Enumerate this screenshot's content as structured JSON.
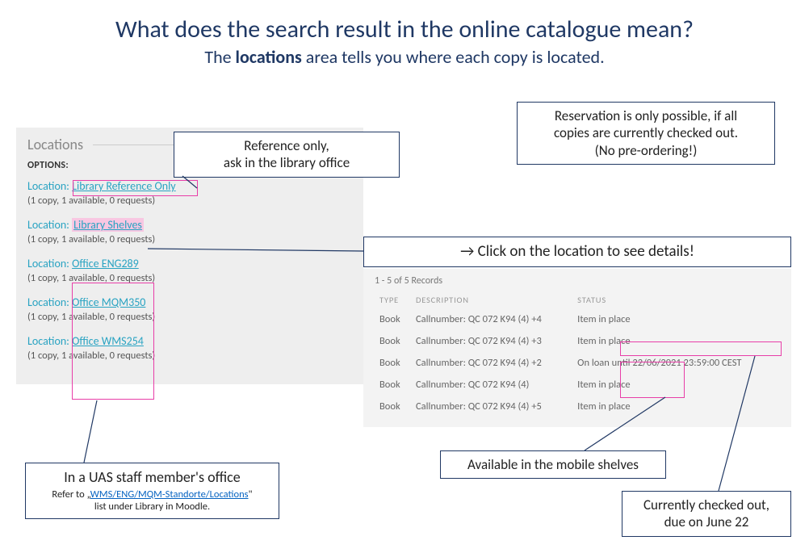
{
  "title": "What does the search result in the online catalogue mean?",
  "subtitle_pre": "The ",
  "subtitle_bold": "locations",
  "subtitle_post": " area tells you where each copy is located.",
  "callout_reference_l1": "Reference only,",
  "callout_reference_l2": "ask in the library office",
  "callout_reservation_l1": "Reservation is only possible, if all",
  "callout_reservation_l2": "copies are currently checked out.",
  "callout_reservation_l3": "(No pre-ordering!)",
  "callout_click": "Click on the location to see details!",
  "arrow_symbol": "→",
  "callout_uas_l1": "In a UAS staff member's office",
  "callout_uas_l2a": "Refer to „",
  "callout_uas_link": "WMS/ENG/MQM-Standorte/Locations",
  "callout_uas_l2b": "\"",
  "callout_uas_l3": "list under Library in Moodle.",
  "callout_mobile": "Available in the mobile shelves",
  "callout_due_l1": "Currently checked out,",
  "callout_due_l2": "due on June 22",
  "locations": {
    "header": "Locations",
    "options": "OPTIONS:",
    "prefix": "Location: ",
    "items": [
      {
        "name": "Library Reference Only",
        "avail": "(1 copy, 1 available, 0 requests)"
      },
      {
        "name": "Library Shelves",
        "avail": "(1 copy, 1 available, 0 requests)"
      },
      {
        "name": "Office ENG289",
        "avail": "(1 copy, 1 available, 0 requests)"
      },
      {
        "name": "Office MQM350",
        "avail": "(1 copy, 1 available, 0 requests)"
      },
      {
        "name": "Office WMS254",
        "avail": "(1 copy, 1 available, 0 requests)"
      }
    ]
  },
  "details": {
    "count": "1 - 5 of 5 Records",
    "th_type": "TYPE",
    "th_desc": "DESCRIPTION",
    "th_status": "STATUS",
    "rows": [
      {
        "type": "Book",
        "desc": "Callnumber: QC 072 K94 (4) +4",
        "status": "Item in place"
      },
      {
        "type": "Book",
        "desc": "Callnumber: QC 072 K94 (4) +3",
        "status": "Item in place"
      },
      {
        "type": "Book",
        "desc": "Callnumber: QC 072 K94 (4) +2",
        "status": "On loan until 22/06/2021 23:59:00 CEST"
      },
      {
        "type": "Book",
        "desc": "Callnumber: QC 072 K94 (4)",
        "status": "Item in place"
      },
      {
        "type": "Book",
        "desc": "Callnumber: QC 072 K94 (4) +5",
        "status": "Item in place"
      }
    ]
  }
}
